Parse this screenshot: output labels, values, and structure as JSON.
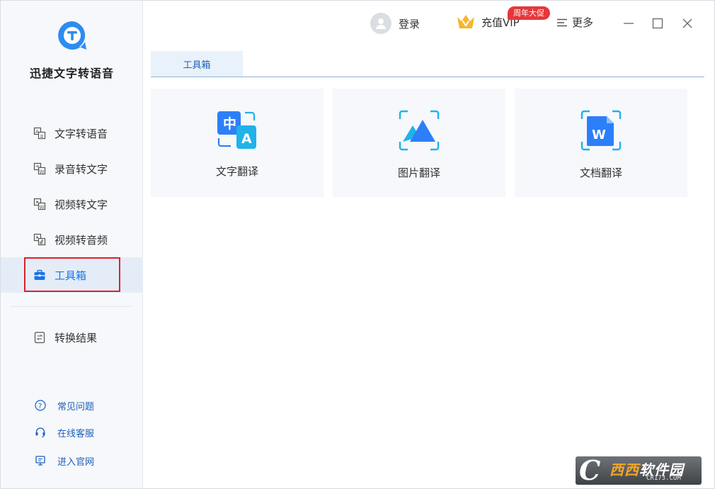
{
  "app": {
    "name": "迅捷文字转语音"
  },
  "topbar": {
    "login_label": "登录",
    "vip_label": "充值VIP",
    "promo_badge": "周年大促",
    "more_label": "更多"
  },
  "sidebar": {
    "items": [
      {
        "label": "文字转语音",
        "icon": "text-to-speech-icon"
      },
      {
        "label": "录音转文字",
        "icon": "audio-to-text-icon"
      },
      {
        "label": "视频转文字",
        "icon": "video-to-text-icon"
      },
      {
        "label": "视频转音频",
        "icon": "video-to-audio-icon"
      },
      {
        "label": "工具箱",
        "icon": "toolbox-icon",
        "active": true
      }
    ],
    "results_label": "转换结果",
    "help": [
      {
        "label": "常见问题",
        "icon": "question-circle-icon"
      },
      {
        "label": "在线客服",
        "icon": "headset-icon"
      },
      {
        "label": "进入官网",
        "icon": "monitor-icon"
      }
    ]
  },
  "main": {
    "tab_label": "工具箱",
    "tools": [
      {
        "label": "文字翻译",
        "icon": "text-translate-icon"
      },
      {
        "label": "图片翻译",
        "icon": "image-translate-icon"
      },
      {
        "label": "文档翻译",
        "icon": "document-translate-icon"
      }
    ]
  },
  "watermark": {
    "brand_a": "西西",
    "brand_b": "软件园",
    "url": "CR173.COM"
  },
  "colors": {
    "accent": "#1a73e8",
    "sidebar_bg": "#f6f8fb",
    "active_bg": "#e4edf7",
    "badge": "#e5383b",
    "outline": "#d9232d"
  }
}
